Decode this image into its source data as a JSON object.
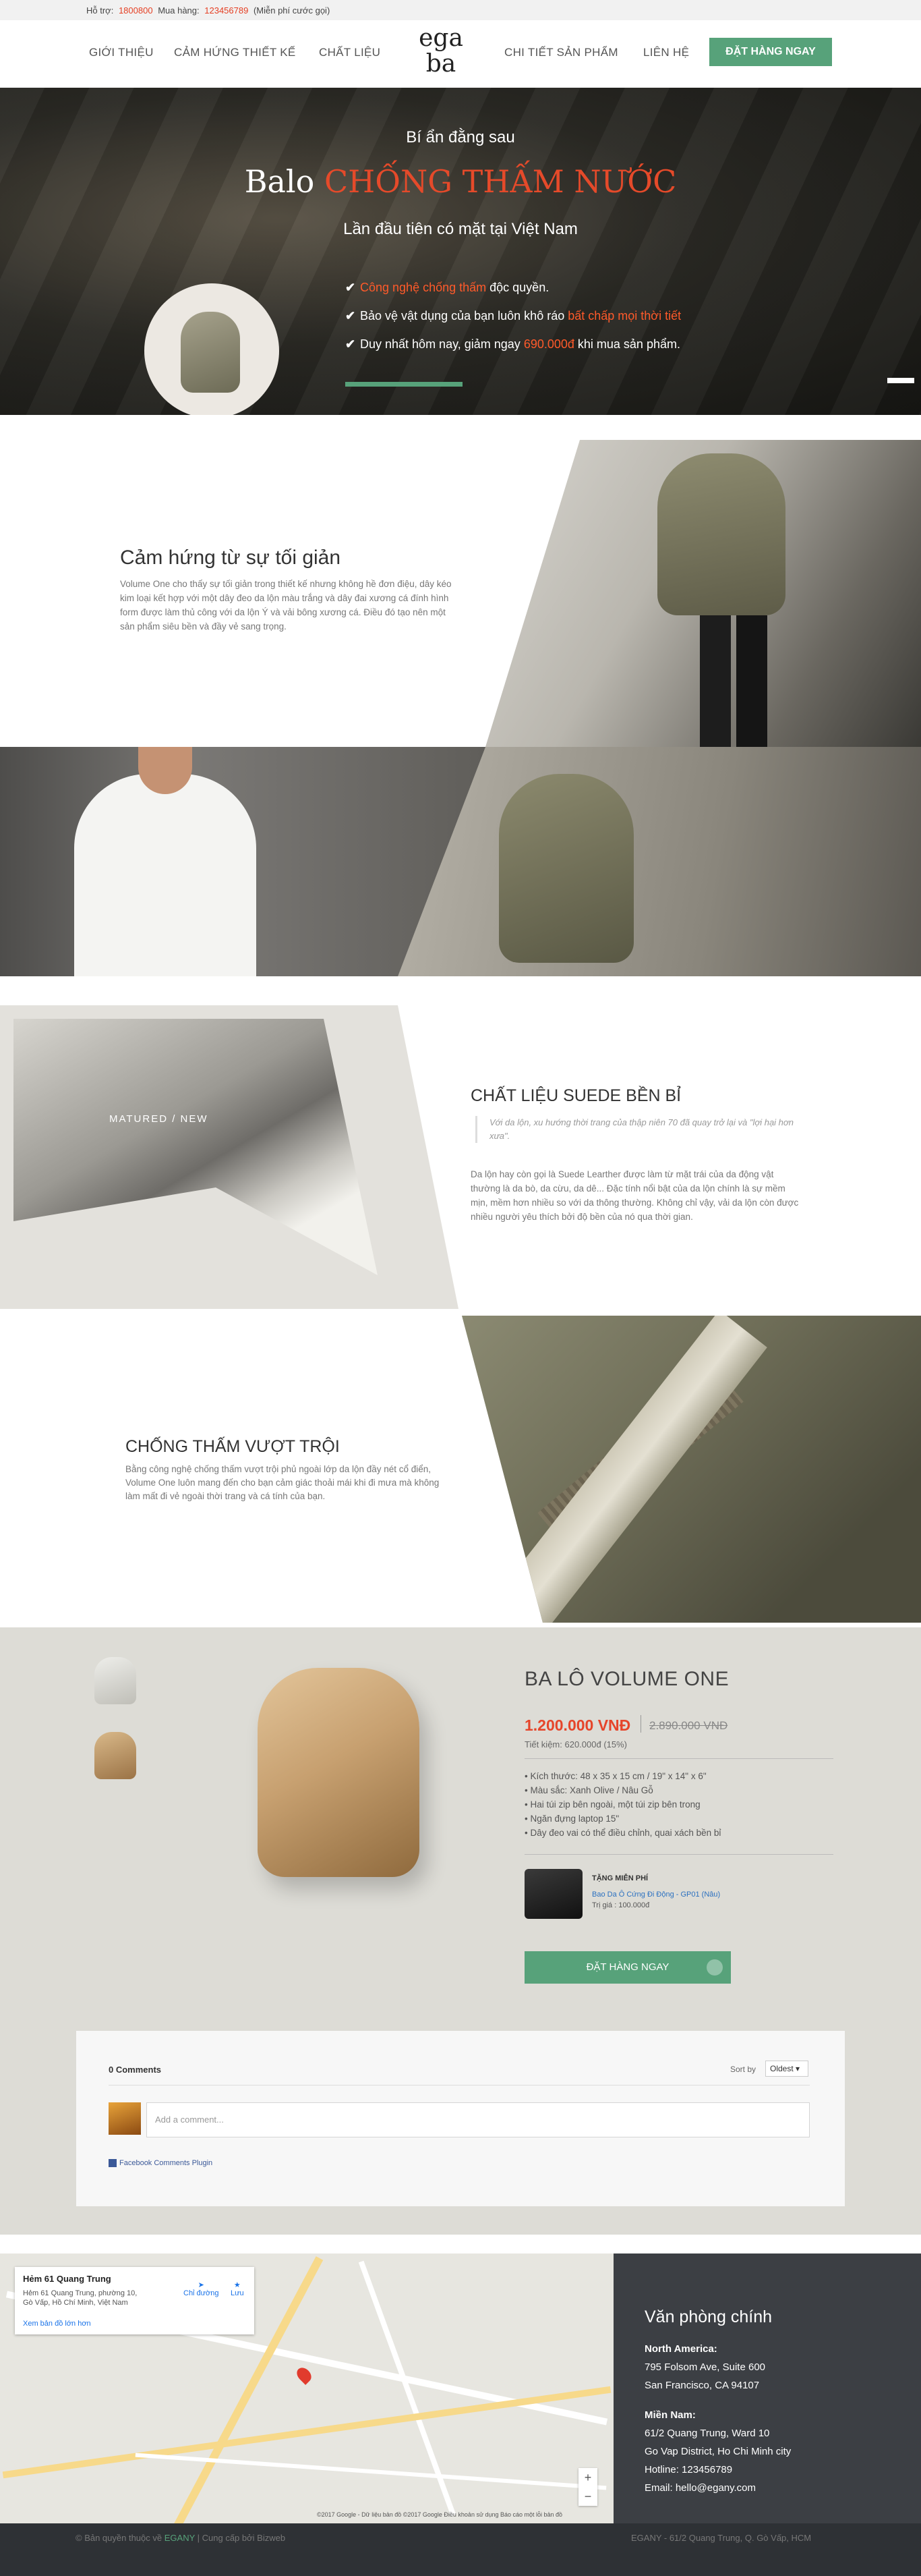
{
  "topbar": {
    "support_label": "Hỗ trợ:",
    "support_phone": "1800800",
    "buy_label": "Mua hàng:",
    "buy_phone": "123456789",
    "free_note": "(Miễn phí cước gọi)"
  },
  "nav": {
    "left": [
      "GIỚI THIỆU",
      "CẢM HỨNG THIẾT KẾ",
      "CHẤT LIỆU"
    ],
    "right": [
      "CHI TIẾT SẢN PHẨM",
      "LIÊN HỆ"
    ],
    "logo_line1": "ega",
    "logo_line2": "ba",
    "cta": "ĐẶT HÀNG NGAY"
  },
  "hero": {
    "subtitle": "Bí ẩn đằng sau",
    "title_plain": "Balo",
    "title_highlight": "CHỐNG THẤM NƯỚC",
    "tagline": "Lần đầu tiên có mặt tại Việt Nam",
    "items": [
      {
        "pre": "",
        "hl": "Công nghệ chống thấm",
        "post": " độc quyền."
      },
      {
        "pre": "Bảo vệ vật dụng của bạn luôn khô ráo ",
        "hl": "bất chấp mọi thời tiết",
        "post": ""
      },
      {
        "pre": "Duy nhất hôm nay, giảm ngay ",
        "hl": "690.000đ",
        "post": " khi mua sản phẩm."
      }
    ],
    "colors": {
      "accent": "#e54a2a",
      "green": "#57a27a"
    }
  },
  "inspiration": {
    "heading": "Cảm hứng từ sự tối giản",
    "body": "Volume One cho thấy sự tối giản trong thiết kế nhưng không hề đơn điệu, dây kéo kim loại kết hợp với một dây đeo da lộn màu trắng và dây đai xương cá đính hình form được làm thủ công với da lộn Ý và vải bông xương cá. Điều đó tạo nên một sản phẩm siêu bền và đầy vẻ sang trọng."
  },
  "material": {
    "heading": "CHẤT LIỆU SUEDE BỀN BỈ",
    "image_label": "MATURED / NEW",
    "quote": "Với da lộn, xu hướng thời trang của thập niên 70 đã quay trở lại và \"lợi hại hơn xưa\".",
    "body": "Da lộn hay còn gọi là Suede Learther được làm từ mặt trái của da động vật thường là da bò, da cừu, da dê... Đặc tính nổi bật của da lộn chính là sự mềm mịn, mềm hơn nhiều so với da thông thường. Không chỉ vậy, vải da lộn còn được nhiều người yêu thích bởi độ bền của nó qua thời gian."
  },
  "waterproof": {
    "heading": "CHỐNG THẤM VƯỢT TRỘI",
    "body": "Bằng công nghệ chống thấm vượt trội phủ ngoài lớp da lộn đầy nét cổ điển, Volume One luôn mang đến cho bạn cảm giác thoải mái khi đi mưa mà không làm mất đi vẻ ngoài thời trang và cá tính của bạn."
  },
  "product": {
    "name": "BA LÔ VOLUME ONE",
    "price": "1.200.000 VNĐ",
    "old_price": "2.890.000 VNĐ",
    "saving_label": "Tiết kiệm:",
    "saving_value": "620.000đ (15%)",
    "features": [
      "Kích thước: 48 x 35 x 15 cm / 19\" x 14\" x 6\"",
      "Màu sắc: Xanh Olive / Nâu Gỗ",
      "Hai túi zip bên ngoài, một túi zip bên trong",
      "Ngăn đựng laptop 15\"",
      "Dây đeo vai có thể điều chỉnh, quai xách bền bỉ"
    ],
    "gift_title": "TẶNG MIỄN PHÍ",
    "gift_desc": "Bao Da Ô Cứng Đi Động - GP01 (Nâu)",
    "gift_price": "Trị giá : 100.000đ",
    "order_button": "ĐẶT HÀNG NGAY"
  },
  "comments": {
    "count": "0 Comments",
    "sort_label": "Sort by",
    "sort_value": "Oldest",
    "placeholder": "Add a comment...",
    "plugin": "Facebook Comments Plugin"
  },
  "map": {
    "place_title": "Hẻm 61 Quang Trung",
    "place_address": "Hẻm 61 Quang Trung, phường 10, Gò Vấp, Hồ Chí Minh, Việt Nam",
    "larger_map": "Xem bản đồ lớn hơn",
    "directions": "Chỉ đường",
    "save": "Lưu",
    "attribution": "©2017 Google - Dữ liệu bản đồ ©2017 Google   Điều khoản sử dụng   Báo cáo một lỗi bản đồ",
    "zoom_in": "+",
    "zoom_out": "−"
  },
  "office": {
    "heading": "Văn phòng chính",
    "north_label": "North America:",
    "north_line1": "795 Folsom Ave, Suite 600",
    "north_line2": "San Francisco, CA 94107",
    "south_label": "Miền Nam:",
    "south_line1": "61/2 Quang Trung, Ward 10",
    "south_line2": "Go Vap District, Ho Chi Minh city",
    "hotline": "Hotline: 123456789",
    "email": "Email: hello@egany.com"
  },
  "footer": {
    "copyright_pre": "© Bản quyền thuộc về",
    "copyright_brand": "EGANY",
    "copyright_post": "| Cung cấp bởi Bizweb",
    "address": "EGANY - 61/2 Quang Trung, Q. Gò Vấp, HCM"
  }
}
